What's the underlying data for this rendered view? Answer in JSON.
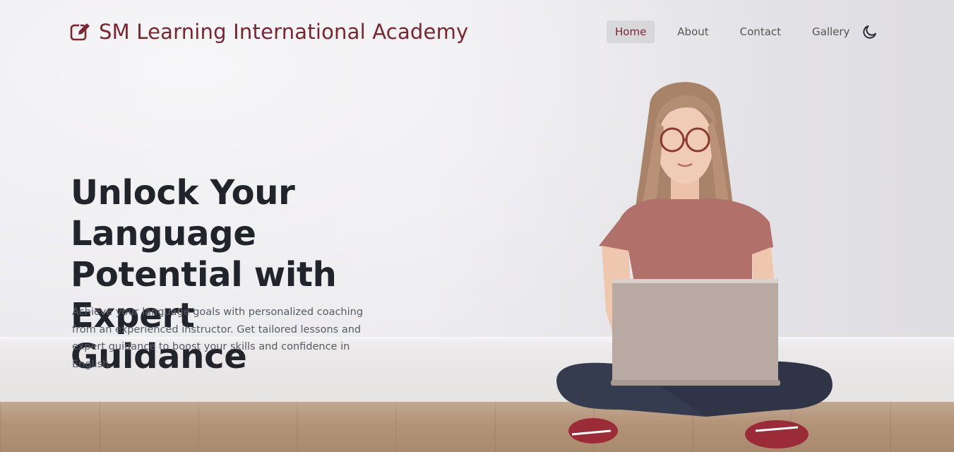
{
  "header": {
    "brand_title": "SM Learning International Academy",
    "brand_icon": "edit-square-icon",
    "nav": [
      {
        "label": "Home",
        "active": true
      },
      {
        "label": "About",
        "active": false
      },
      {
        "label": "Contact",
        "active": false
      },
      {
        "label": "Gallery",
        "active": false
      }
    ],
    "theme_toggle_icon": "moon-icon"
  },
  "hero": {
    "headline_line1": "Unlock Your Language",
    "headline_line2": "Potential with Expert",
    "headline_line3": "Guidance",
    "subtext": "Achieve your language goals with personalized coaching from an experienced instructor. Get tailored lessons and expert guidance to boost your skills and confidence in English."
  },
  "colors": {
    "brand": "#7a2530",
    "headline": "#22242c",
    "body_text": "#585b63",
    "nav_text": "#555555"
  }
}
